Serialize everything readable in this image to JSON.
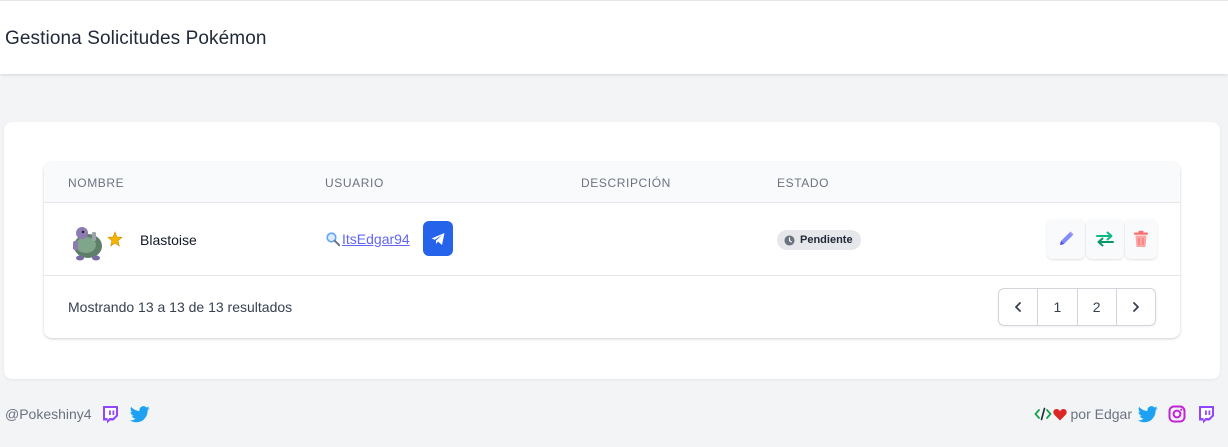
{
  "header": {
    "title": "Gestiona Solicitudes Pokémon"
  },
  "table": {
    "columns": [
      "Nombre",
      "Usuario",
      "Descripción",
      "Estado"
    ],
    "rows": [
      {
        "pokemon_name": "Blastoise",
        "shiny": true,
        "sprite_icon": "blastoise-sprite-icon",
        "user": "ItsEdgar94",
        "description": "",
        "status": "Pendiente",
        "actions": [
          "pencil-icon",
          "swap-arrows-icon",
          "trash-icon"
        ]
      }
    ],
    "footer_text": "Mostrando 13 a 13 de 13 resultados",
    "pagination": {
      "pages": [
        "1",
        "2"
      ],
      "prev_icon": "chevron-left-icon",
      "next_icon": "chevron-right-icon"
    }
  },
  "footer": {
    "left_handle": "@Pokeshiny4",
    "left_icons": [
      "twitch-icon",
      "twitter-icon"
    ],
    "right_text": "por Edgar",
    "right_icons": [
      "code-icon",
      "heart-icon",
      "twitter-icon",
      "instagram-icon",
      "twitch-icon"
    ]
  },
  "colors": {
    "accent": "#6366f1",
    "telegram_button": "#2563eb",
    "edit": "#6366f1",
    "swap": "#10b981",
    "delete": "#f87171",
    "twitch": "#9146ff",
    "twitter": "#1da1f2",
    "instagram": "#c026d3",
    "heart": "#dc2626"
  }
}
